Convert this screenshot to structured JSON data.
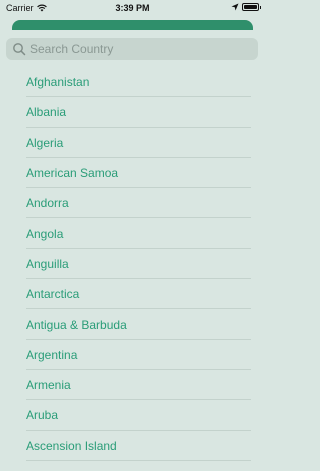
{
  "status_bar": {
    "carrier": "Carrier",
    "time": "3:39 PM"
  },
  "search": {
    "placeholder": "Search Country"
  },
  "countries": [
    "Afghanistan",
    "Albania",
    "Algeria",
    "American Samoa",
    "Andorra",
    "Angola",
    "Anguilla",
    "Antarctica",
    "Antigua & Barbuda",
    "Argentina",
    "Armenia",
    "Aruba",
    "Ascension Island"
  ],
  "colors": {
    "background": "#d9e6e1",
    "accent": "#2a9d78",
    "header": "#2f8f6b"
  }
}
